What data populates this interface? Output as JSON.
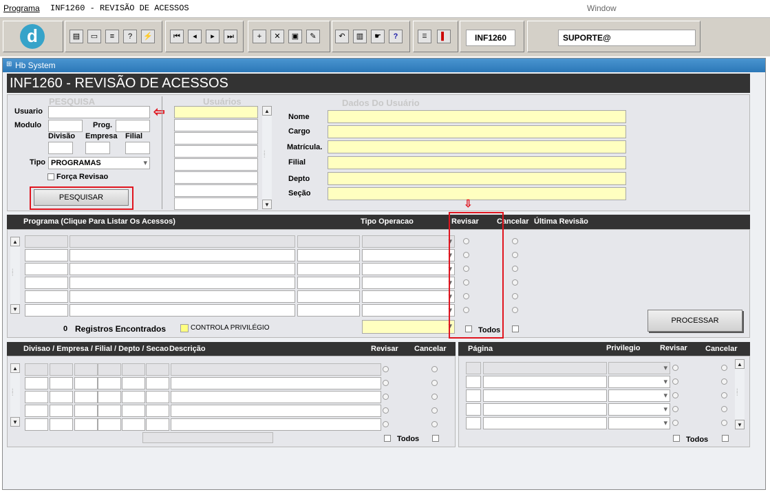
{
  "menubar": {
    "programa": "Programa",
    "title": "INF1260 - REVISÃO DE ACESSOS",
    "window": "Window"
  },
  "toolbar": {
    "form_code": "INF1260",
    "user": "SUPORTE@",
    "logo": "d"
  },
  "window": {
    "title": "Hb System"
  },
  "header": {
    "title": "INF1260 - REVISÃO DE ACESSOS"
  },
  "pesquisa": {
    "section": "PESQUISA",
    "usuario": "Usuario",
    "modulo": "Modulo",
    "prog": "Prog.",
    "divisao": "Divisão",
    "empresa": "Empresa",
    "filial": "Filial",
    "tipo": "Tipo",
    "tipo_value": "PROGRAMAS",
    "forca_revisao": "Força Revisao",
    "button": "PESQUISAR"
  },
  "usuarios": {
    "section": "Usuários"
  },
  "dados": {
    "section": "Dados Do Usuário",
    "fields": [
      "Nome",
      "Cargo",
      "Matrícula.",
      "Filial",
      "Depto",
      "Seção"
    ]
  },
  "programas": {
    "header_programa": "Programa (Clique Para Listar Os Acessos)",
    "header_tipo": "Tipo Operacao",
    "header_revisar": "Revisar",
    "header_cancelar": "Cancelar",
    "header_ultima": "Última Revisão",
    "count": "0",
    "registros": "Registros Encontrados",
    "controla": "CONTROLA PRIVILÉGIO",
    "todos": "Todos",
    "button": "PROCESSAR"
  },
  "bottom_left": {
    "header": "Divisao / Empresa / Filial / Depto / Secao",
    "descricao": "Descrição",
    "revisar": "Revisar",
    "cancelar": "Cancelar",
    "todos": "Todos"
  },
  "bottom_right": {
    "pagina": "Página",
    "privilegio": "Privilegio",
    "revisar": "Revisar",
    "cancelar": "Cancelar",
    "todos": "Todos"
  },
  "colors": {
    "highlight_red": "#e0141e",
    "field_yellow": "#ffffc0",
    "title_blue": "#2c78b8",
    "header_dark": "#333333"
  },
  "icons": [
    "save-icon",
    "window-icon",
    "print-icon",
    "query-icon",
    "execute-icon",
    "first-record-icon",
    "prev-record-icon",
    "next-record-icon",
    "last-record-icon",
    "insert-icon",
    "delete-icon",
    "clear-icon",
    "edit-icon",
    "undo-icon",
    "clipboard-icon",
    "tools-icon",
    "help-icon",
    "menu-icon",
    "exit-icon"
  ]
}
